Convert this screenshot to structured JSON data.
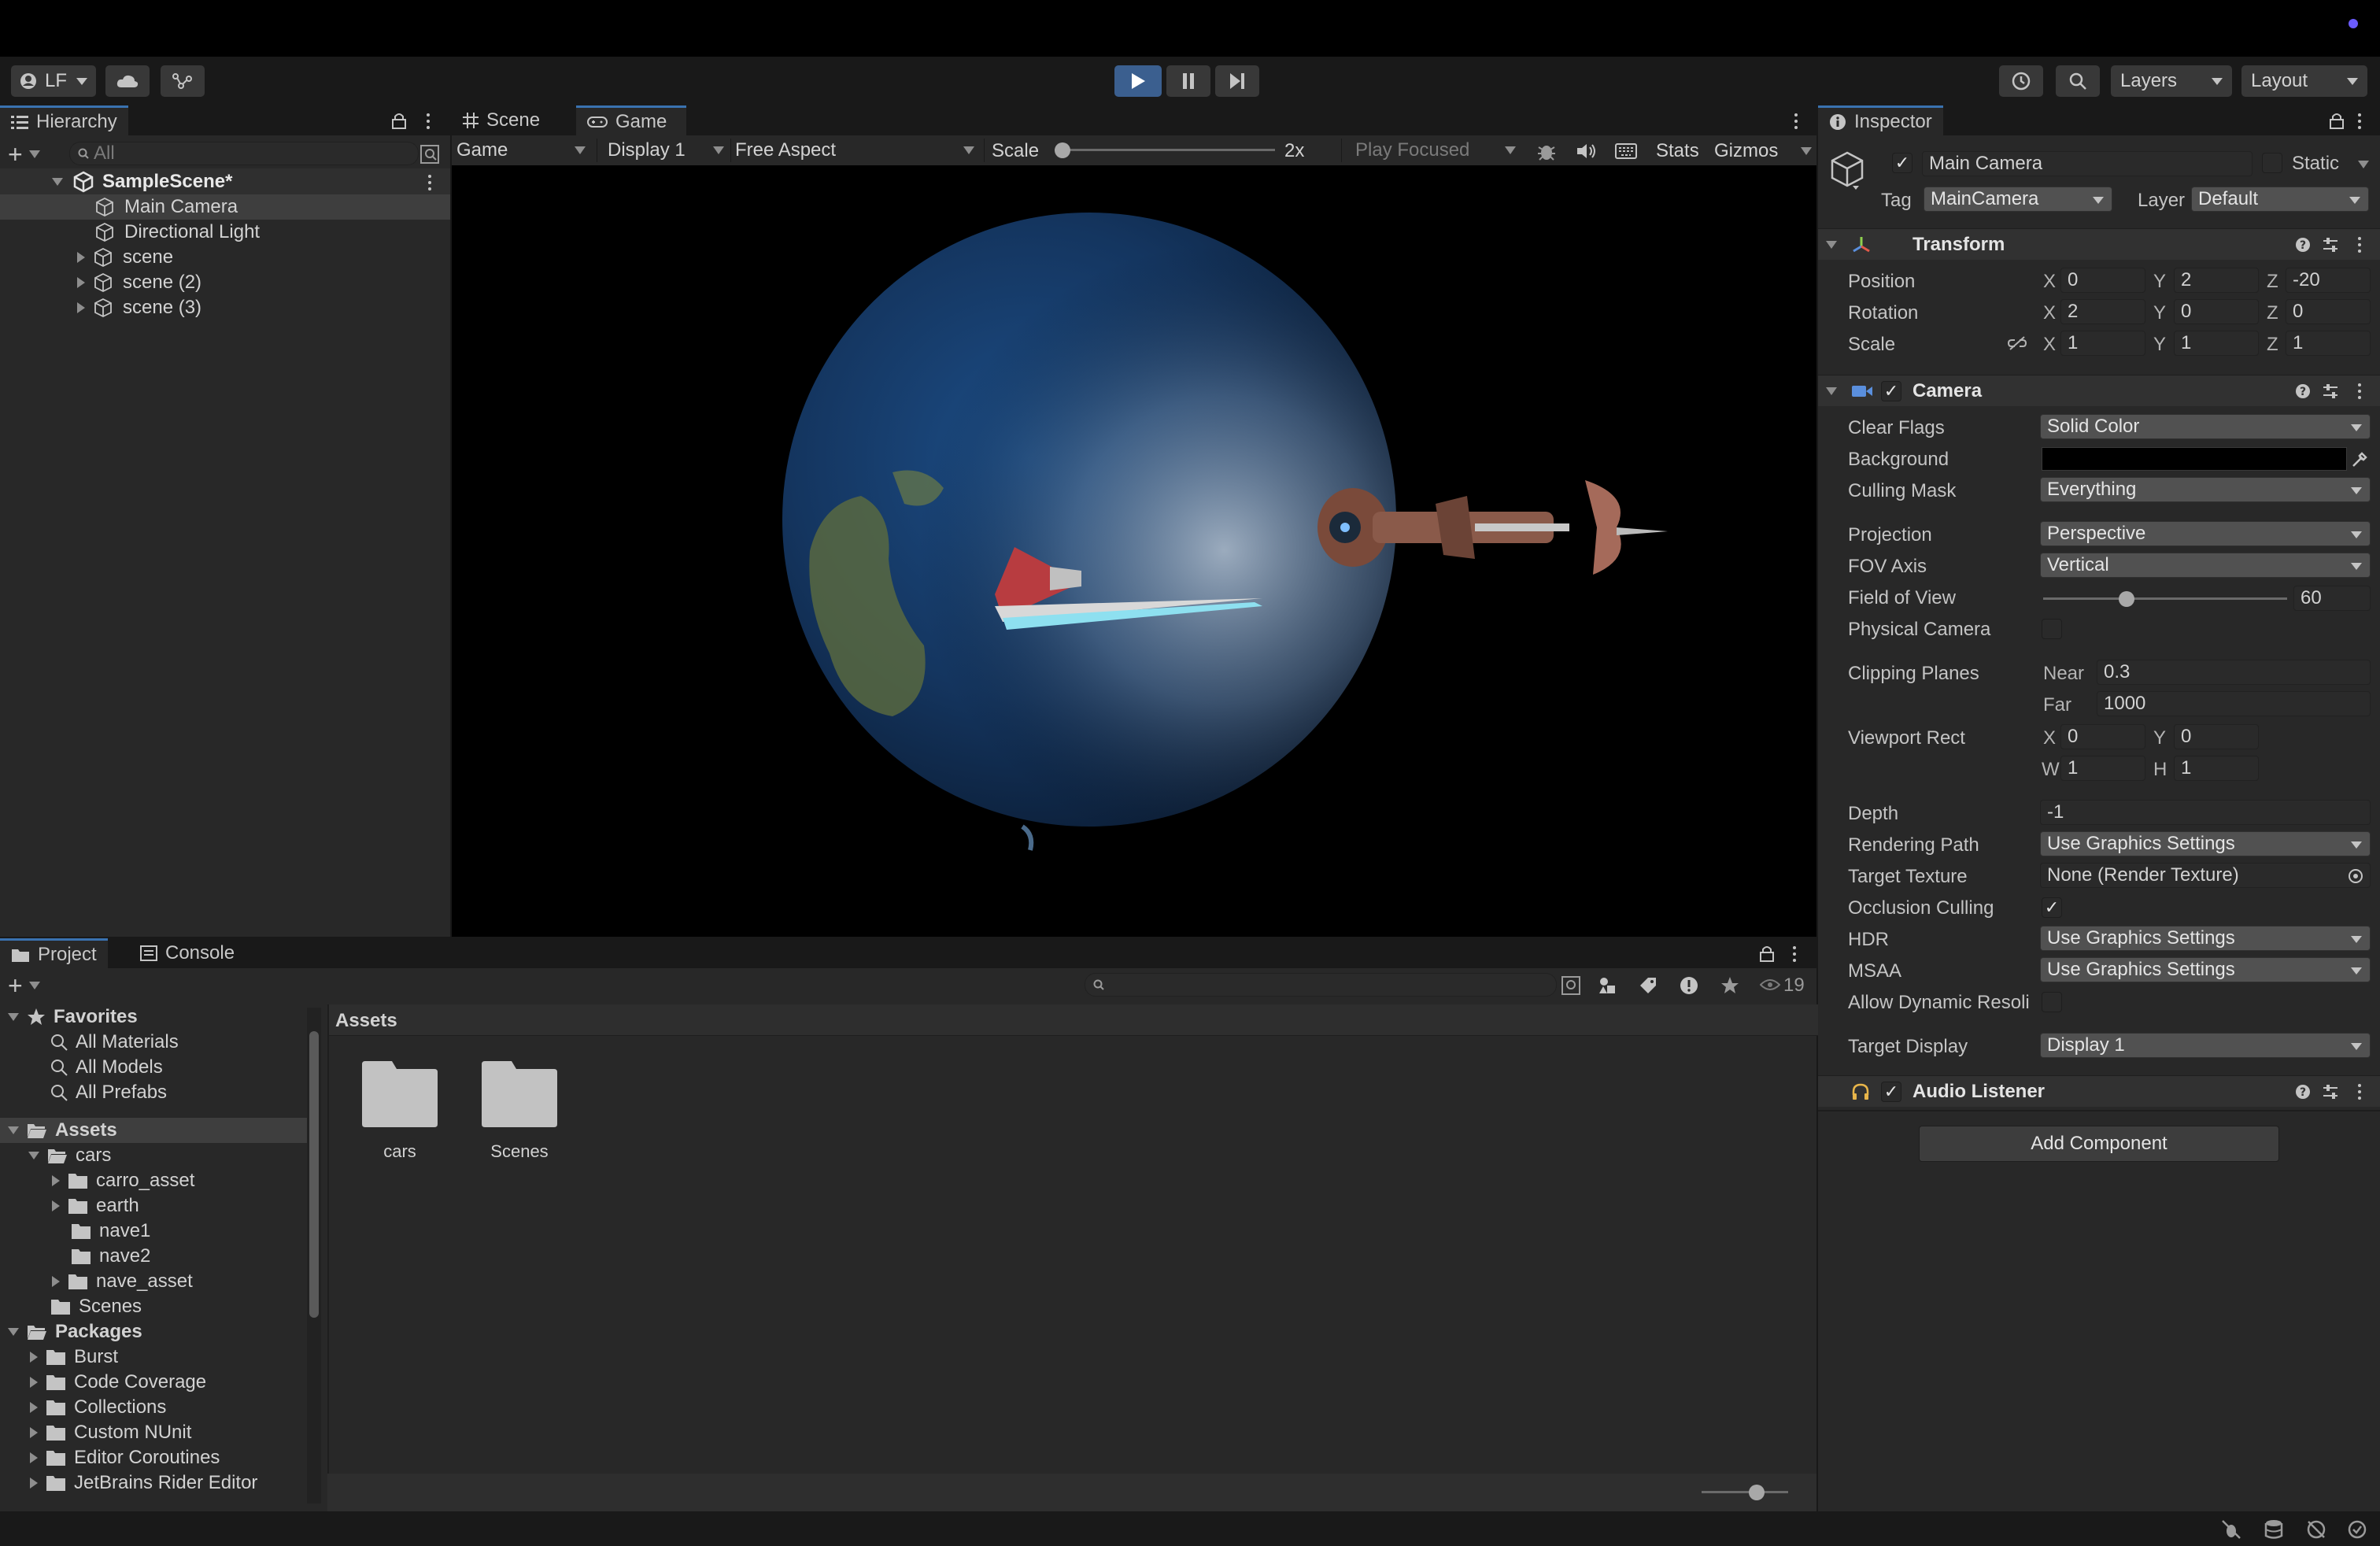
{
  "toolbar": {
    "account": "LF",
    "layers": "Layers",
    "layout": "Layout"
  },
  "hierarchy": {
    "tab": "Hierarchy",
    "search_placeholder": "All",
    "scene": "SampleScene*",
    "items": [
      {
        "label": "Main Camera"
      },
      {
        "label": "Directional Light"
      },
      {
        "label": "scene"
      },
      {
        "label": "scene (2)"
      },
      {
        "label": "scene (3)"
      }
    ]
  },
  "game": {
    "tabs": [
      "Scene",
      "Game"
    ],
    "display_mode": "Game",
    "display": "Display 1",
    "aspect": "Free Aspect",
    "scale_label": "Scale",
    "scale_value": "2x",
    "scale_level": 0.0,
    "play_focused": "Play Focused",
    "stats": "Stats",
    "gizmos": "Gizmos"
  },
  "project": {
    "tabs": [
      "Project",
      "Console"
    ],
    "hidden_count": "19",
    "breadcrumb": "Assets",
    "favorites": {
      "label": "Favorites",
      "items": [
        "All Materials",
        "All Models",
        "All Prefabs"
      ]
    },
    "assets_label": "Assets",
    "cars_label": "cars",
    "cars_children": [
      "carro_asset",
      "earth",
      "nave1",
      "nave2",
      "nave_asset"
    ],
    "scenes_label": "Scenes",
    "packages_label": "Packages",
    "packages": [
      "Burst",
      "Code Coverage",
      "Collections",
      "Custom NUnit",
      "Editor Coroutines",
      "JetBrains Rider Editor"
    ],
    "grid_items": [
      {
        "label": "cars"
      },
      {
        "label": "Scenes"
      }
    ]
  },
  "inspector": {
    "tab": "Inspector",
    "object_name": "Main Camera",
    "static_label": "Static",
    "tag_label": "Tag",
    "tag_value": "MainCamera",
    "layer_label": "Layer",
    "layer_value": "Default",
    "transform": {
      "title": "Transform",
      "position_label": "Position",
      "rotation_label": "Rotation",
      "scale_label": "Scale",
      "position": {
        "x": "0",
        "y": "2",
        "z": "-20"
      },
      "rotation": {
        "x": "2",
        "y": "0",
        "z": "0"
      },
      "scale": {
        "x": "1",
        "y": "1",
        "z": "1"
      }
    },
    "camera": {
      "title": "Camera",
      "clear_flags_label": "Clear Flags",
      "clear_flags": "Solid Color",
      "background_label": "Background",
      "background_color": "#000000",
      "culling_mask_label": "Culling Mask",
      "culling_mask": "Everything",
      "projection_label": "Projection",
      "projection": "Perspective",
      "fov_axis_label": "FOV Axis",
      "fov_axis": "Vertical",
      "fov_label": "Field of View",
      "fov": "60",
      "fov_level": 0.33,
      "physical_camera_label": "Physical Camera",
      "clipping_label": "Clipping Planes",
      "near_label": "Near",
      "near": "0.3",
      "far_label": "Far",
      "far": "1000",
      "viewport_label": "Viewport Rect",
      "viewport": {
        "x": "0",
        "y": "0",
        "w": "1",
        "h": "1"
      },
      "depth_label": "Depth",
      "depth": "-1",
      "rendering_path_label": "Rendering Path",
      "rendering_path": "Use Graphics Settings",
      "target_texture_label": "Target Texture",
      "target_texture": "None (Render Texture)",
      "occlusion_label": "Occlusion Culling",
      "hdr_label": "HDR",
      "hdr": "Use Graphics Settings",
      "msaa_label": "MSAA",
      "msaa": "Use Graphics Settings",
      "dynamic_res_label": "Allow Dynamic Resoli",
      "target_display_label": "Target Display",
      "target_display": "Display 1"
    },
    "audio_listener": "Audio Listener",
    "add_component": "Add Component"
  },
  "colors": {
    "accent": "#3a72b0",
    "panel": "#282828",
    "field": "#2a2a2a"
  }
}
